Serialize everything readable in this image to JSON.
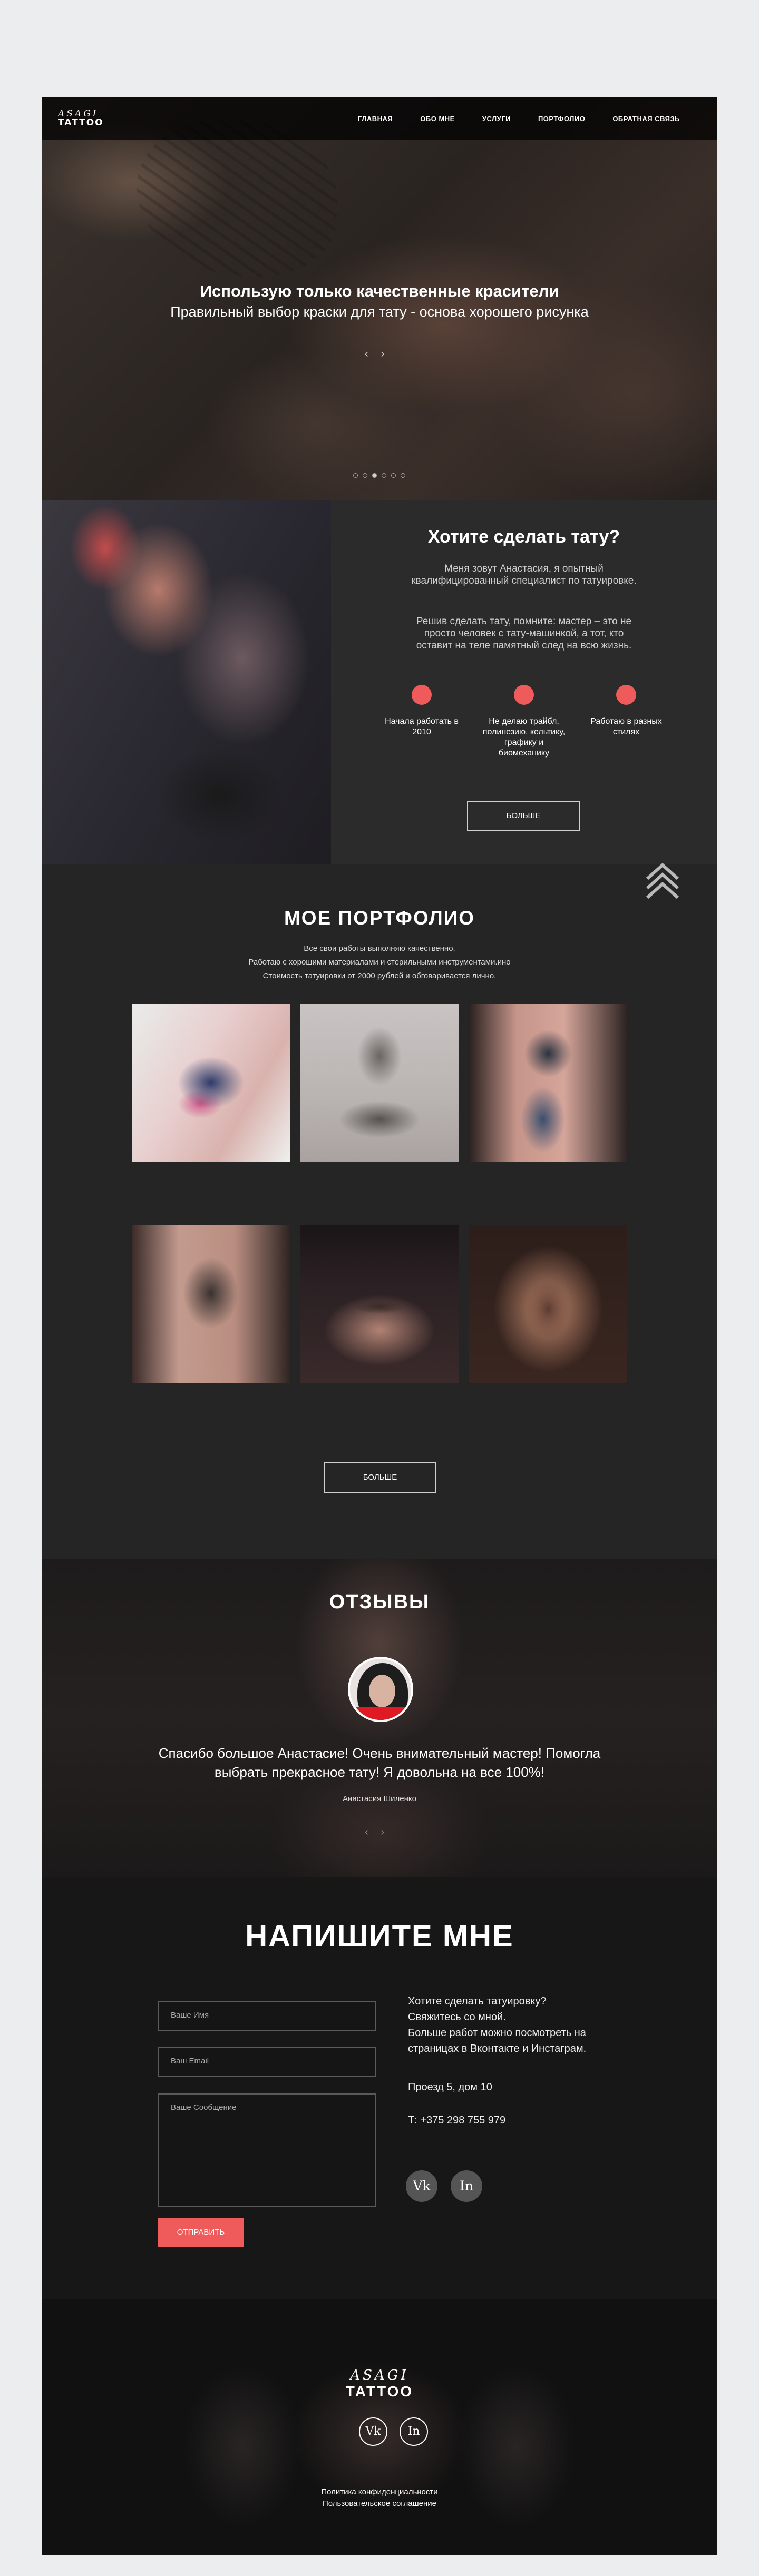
{
  "header": {
    "logo_top": "ASAGI",
    "logo_bottom": "TATTOO",
    "nav": [
      "ГЛАВНАЯ",
      "ОБО МНЕ",
      "УСЛУГИ",
      "ПОРТФОЛИО",
      "ОБРАТНАЯ СВЯЗЬ"
    ]
  },
  "hero": {
    "title": "Использую только качественные красители",
    "subtitle": "Правильный выбор краски для тату - основа хорошего рисунка",
    "prev": "‹",
    "next": "›",
    "slides_count": 6,
    "active_slide": 3
  },
  "about": {
    "title": "Хотите сделать тату?",
    "p1": "Меня зовут Анастасия, я опытный квалифицированный специалист по татуировке.",
    "p2": "Решив сделать тату, помните: мастер – это не просто человек с тату-машинкой, а тот, кто оставит на теле памятный след на всю жизнь.",
    "features": [
      "Начала работать в 2010",
      "Не делаю трайбл, полинезию, кельтику, графику и биомеханику",
      "Работаю в разных стилях"
    ],
    "more_button": "БОЛЬШЕ",
    "accent_color": "#ef5b5b"
  },
  "portfolio": {
    "title": "МОЕ ПОРТФОЛИО",
    "desc": [
      "Все свои работы выполняю качественно.",
      "Работаю с хорошими материалами и стерильными инструментами.ино",
      "Стоимость татуировки от 2000 рублей и обговаривается лично."
    ],
    "more_button": "БОЛЬШЕ"
  },
  "reviews": {
    "title": "ОТЗЫВЫ",
    "text": "Спасибо большое Анастасие! Очень внимательный мастер! Помогла выбрать прекрасное тату! Я довольна на все 100%!",
    "author": "Анастасия Шиленко",
    "prev": "‹",
    "next": "›"
  },
  "contact": {
    "title": "НАПИШИТЕ МНЕ",
    "name_placeholder": "Ваше Имя",
    "email_placeholder": "Ваш Email",
    "message_placeholder": "Ваше Сообщение",
    "send_button": "ОТПРАВИТЬ",
    "info": [
      "Хотите сделать татуировку?",
      "Свяжитесь со мной.",
      "Больше работ можно посмотреть на",
      "страницах в Вконтакте и Инстаграм."
    ],
    "address": "Проезд 5, дом 10",
    "phone": "Т: +375 298 755 979",
    "vk": "Vk",
    "in": "In"
  },
  "footer": {
    "logo_top": "ASAGI",
    "logo_bottom": "TATTOO",
    "vk": "Vk",
    "in": "In",
    "privacy": "Политика конфиденциальности",
    "agreement": "Пользовательское соглашение"
  }
}
